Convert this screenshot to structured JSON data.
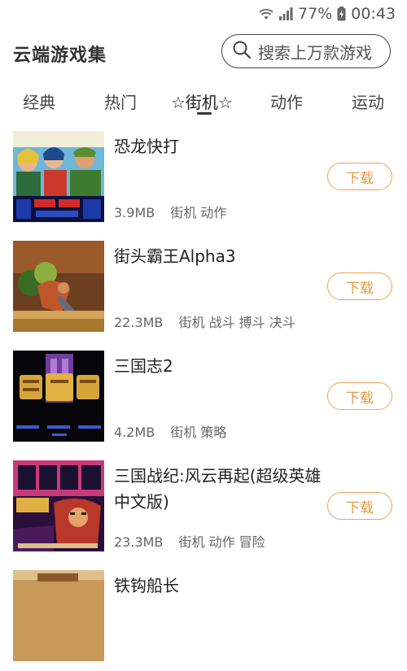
{
  "status": {
    "battery": "77%",
    "time": "00:43"
  },
  "header": {
    "title": "云端游戏集",
    "search_placeholder": "搜索上万款游戏"
  },
  "tabs": [
    {
      "label": "经典",
      "active": false
    },
    {
      "label": "热门",
      "active": false
    },
    {
      "label": "☆街机☆",
      "active": true
    },
    {
      "label": "动作",
      "active": false
    },
    {
      "label": "运动",
      "active": false
    }
  ],
  "games": [
    {
      "name": "恐龙快打",
      "size": "3.9MB",
      "tags": "街机 动作",
      "button": "下载"
    },
    {
      "name": "街头霸王Alpha3",
      "size": "22.3MB",
      "tags": "街机 战斗 搏斗 决斗",
      "button": "下载"
    },
    {
      "name": "三国志2",
      "size": "4.2MB",
      "tags": "街机 策略",
      "button": "下载"
    },
    {
      "name": "三国战纪:风云再起(超级英雄 中文版)",
      "size": "23.3MB",
      "tags": "街机 动作 冒险",
      "button": "下载"
    },
    {
      "name": "铁钩船长",
      "size": "",
      "tags": "",
      "button": ""
    }
  ],
  "colors": {
    "accent": "#e39a45",
    "accent_border": "#e7a55a"
  }
}
